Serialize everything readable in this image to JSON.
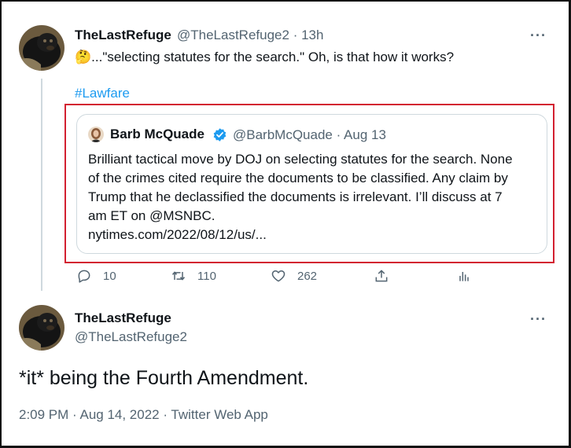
{
  "first_tweet": {
    "display_name": "TheLastRefuge",
    "handle": "@TheLastRefuge2",
    "time": "· 13h",
    "text": "🤔...\"selecting statutes for the search.\"  Oh, is that how it works?",
    "hashtag": "#Lawfare",
    "more": "···"
  },
  "quoted_tweet": {
    "display_name": "Barb McQuade",
    "handle_time": "@BarbMcQuade · Aug 13",
    "lines": [
      "Brilliant tactical move by DOJ on selecting statutes for the search. None",
      "of the crimes cited require the documents to be classified. Any claim by",
      "Trump that he declassified the documents is irrelevant. I’ll discuss at 7",
      "am ET on @MSNBC.",
      "nytimes.com/2022/08/12/us/..."
    ],
    "verified_color": "#1d9bf0"
  },
  "actions": {
    "replies": "10",
    "retweets": "110",
    "likes": "262"
  },
  "second_tweet": {
    "display_name": "TheLastRefuge",
    "handle": "@TheLastRefuge2",
    "more": "···",
    "text": "*it* being the Fourth Amendment.",
    "meta": "2:09 PM · Aug 14, 2022 · Twitter Web App"
  },
  "colors": {
    "highlight_border": "#d32030",
    "link": "#1d9bf0",
    "secondary_text": "#536471"
  }
}
